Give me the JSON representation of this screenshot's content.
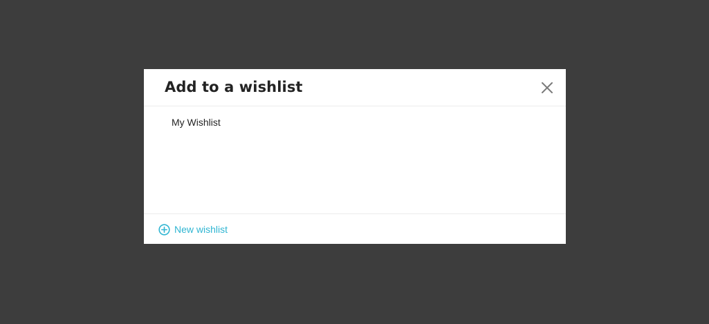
{
  "modal": {
    "title": "Add to a wishlist",
    "close_icon": "close-icon",
    "wishlists": [
      {
        "label": "My Wishlist"
      }
    ],
    "footer": {
      "new_wishlist_label": "New wishlist",
      "new_wishlist_icon": "plus-circle-icon"
    }
  },
  "colors": {
    "overlay": "#3d3d3d",
    "modal_background": "#ffffff",
    "title_text": "#232323",
    "accent": "#2fb5d2",
    "divider": "#ececec",
    "close_icon": "#7a7a7a"
  }
}
